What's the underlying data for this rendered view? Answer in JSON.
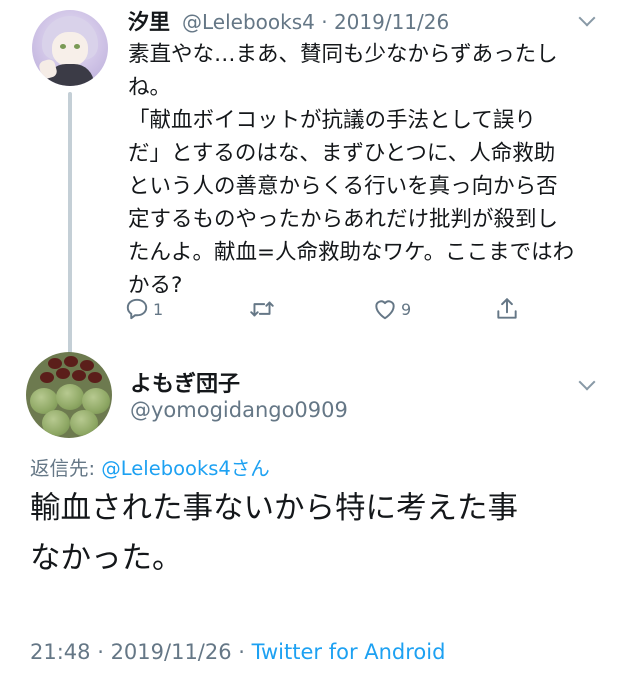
{
  "parent_tweet": {
    "display_name": "汐里",
    "handle": "@Lelebooks4",
    "separator": "·",
    "date": "2019/11/26",
    "text": "素直やな…まあ、賛同も少なからずあったし\nね。\n「献血ボイコットが抗議の手法として誤り\nだ」とするのはな、まずひとつに、人命救助\nという人の善意からくる行いを真っ向から否\n定するものやったからあれだけ批判が殺到し\nたんよ。献血=人命救助なワケ。ここまではわ\nかる?",
    "actions": {
      "reply_count": "1",
      "retweet_count": "",
      "like_count": "9"
    }
  },
  "main_tweet": {
    "display_name": "よもぎ団子",
    "handle": "@yomogidango0909",
    "reply_prefix": "返信先: ",
    "reply_to": "@Lelebooks4さん",
    "text": "輸血された事ないから特に考えた事\nなかった。",
    "time": "21:48",
    "separator": " · ",
    "date": "2019/11/26",
    "source": "Twitter for Android"
  },
  "colors": {
    "text": "#14171a",
    "secondary": "#657786",
    "link": "#1da1f2",
    "thread_line": "#c4cfd6"
  }
}
